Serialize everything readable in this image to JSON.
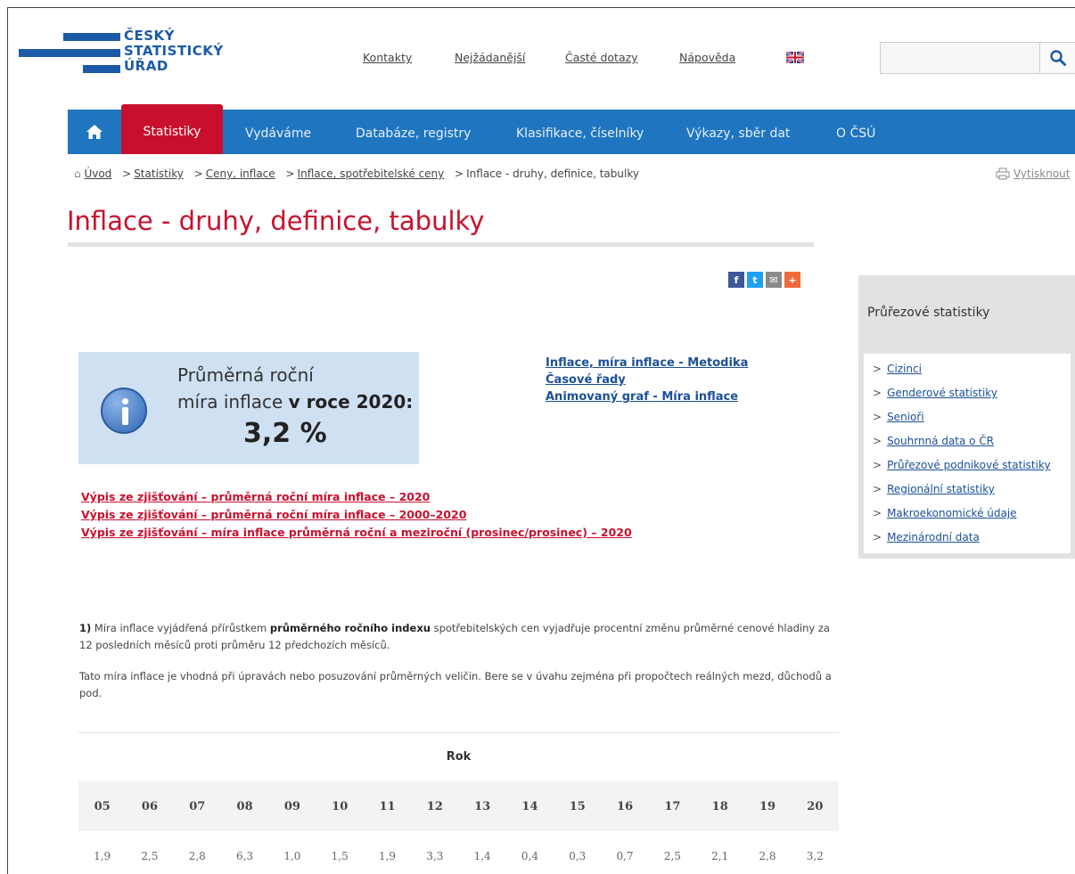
{
  "logo": {
    "line1": "ČESKÝ",
    "line2": "STATISTICKÝ",
    "line3": "ÚŘAD"
  },
  "toplinks": [
    "Kontakty",
    "Nejžádanější",
    "Časté dotazy",
    "Nápověda"
  ],
  "search": {
    "placeholder": ""
  },
  "nav": {
    "items": [
      "Statistiky",
      "Vydáváme",
      "Databáze, registry",
      "Klasifikace, číselníky",
      "Výkazy, sběr dat",
      "O ČSÚ"
    ]
  },
  "breadcrumb": {
    "items": [
      "Úvod",
      "Statistiky",
      "Ceny, inflace",
      "Inflace, spotřebitelské ceny"
    ],
    "current": "Inflace - druhy, definice, tabulky"
  },
  "print_label": "Vytisknout",
  "page_title": "Inflace - druhy, definice, tabulky",
  "infobox": {
    "line1": "Průměrná roční",
    "line2_prefix": "míra inflace",
    "line2_bold": "v roce 2020:",
    "value": "3,2 %"
  },
  "right_links": [
    "Inflace, míra inflace - Metodika",
    "Časové řady",
    "Animovaný graf - Míra inflace"
  ],
  "red_links": [
    "Výpis ze zjišťování – průměrná roční míra inflace – 2020",
    "Výpis ze zjišťování – průměrná roční míra inflace – 2000–2020",
    "Výpis ze zjišťování – míra inflace průměrná roční a meziroční (prosinec/prosinec) – 2020"
  ],
  "sidebar": {
    "heading": "Průřezové statistiky",
    "items": [
      "Cizinci",
      "Genderové statistiky",
      "Senioři",
      "Souhrnná data o ČR",
      "Průřezové podnikové statistiky",
      "Regionální statistiky",
      "Makroekonomické údaje",
      "Mezinárodní data"
    ]
  },
  "para1": {
    "num": "1)",
    "pre": "Míra inflace vyjádřená přírůstkem",
    "bold": "průměrného ročního indexu",
    "post": "spotřebitelských cen vyjadřuje procentní změnu průměrné cenové hladiny za 12 posledních měsíců proti průměru 12 předchozích měsíců."
  },
  "para2": "Tato míra inflace je vhodná při úpravách nebo posuzování průměrných veličin. Bere se v úvahu zejména při propočtech reálných mezd, důchodů a pod.",
  "table": {
    "header": "Rok",
    "years": [
      "05",
      "06",
      "07",
      "08",
      "09",
      "10",
      "11",
      "12",
      "13",
      "14",
      "15",
      "16",
      "17",
      "18",
      "19",
      "20"
    ],
    "values": [
      "1,9",
      "2,5",
      "2,8",
      "6,3",
      "1,0",
      "1,5",
      "1,9",
      "3,3",
      "1,4",
      "0,4",
      "0,3",
      "0,7",
      "2,5",
      "2,1",
      "2,8",
      "3,2"
    ]
  }
}
